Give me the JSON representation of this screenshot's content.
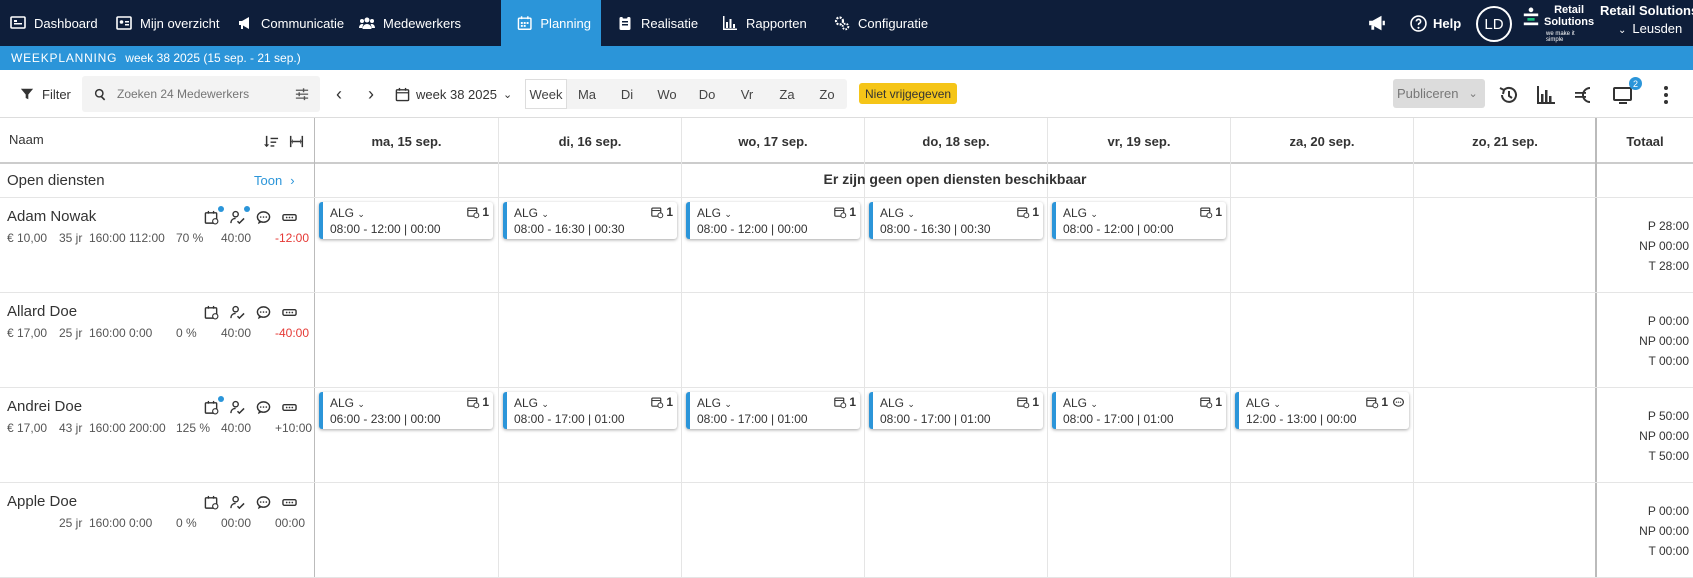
{
  "nav": {
    "items": [
      {
        "label": "Dashboard",
        "icon": "dashboard-icon"
      },
      {
        "label": "Mijn overzicht",
        "icon": "id-card-icon"
      },
      {
        "label": "Communicatie",
        "icon": "megaphone-icon"
      },
      {
        "label": "Medewerkers",
        "icon": "users-icon"
      },
      {
        "label": "Planning",
        "icon": "calendar-icon",
        "active": true
      },
      {
        "label": "Realisatie",
        "icon": "clipboard-icon"
      },
      {
        "label": "Rapporten",
        "icon": "bar-chart-icon"
      },
      {
        "label": "Configuratie",
        "icon": "gears-icon"
      }
    ],
    "help_label": "Help",
    "avatar_initials": "LD",
    "logo_line1": "Retail",
    "logo_line2": "Solutions",
    "logo_tagline": "we make it simple",
    "store_name": "Retail Solutions",
    "store_location": "Leusden"
  },
  "subbar": {
    "title": "WEEKPLANNING",
    "range": "week 38 2025 (15 sep. - 21 sep.)"
  },
  "toolbar": {
    "filter_label": "Filter",
    "search_placeholder": "Zoeken 24 Medewerkers",
    "week_label": "week 38 2025",
    "days": [
      "Week",
      "Ma",
      "Di",
      "Wo",
      "Do",
      "Vr",
      "Za",
      "Zo"
    ],
    "selected_day": "Week",
    "status_badge": "Niet vrijgegeven",
    "publish_label": "Publiceren",
    "notification_count": "2"
  },
  "grid": {
    "name_header": "Naam",
    "total_header": "Totaal",
    "columns": [
      "ma, 15 sep.",
      "di, 16 sep.",
      "wo, 17 sep.",
      "do, 18 sep.",
      "vr, 19 sep.",
      "za, 20 sep.",
      "zo, 21 sep."
    ],
    "open_label": "Open diensten",
    "open_toggle": "Toon",
    "open_message": "Er zijn geen open diensten beschikbaar"
  },
  "employees": [
    {
      "name": "Adam Nowak",
      "wage": "€ 10,00",
      "age": "35 jr",
      "contract": "160:00",
      "planned_month": "112:00",
      "percent": "70 %",
      "week_hours": "40:00",
      "delta": "-12:00",
      "delta_negative": true,
      "shifts": [
        {
          "day": 0,
          "code": "ALG",
          "time": "08:00 - 12:00 | 00:00",
          "count": "1"
        },
        {
          "day": 1,
          "code": "ALG",
          "time": "08:00 - 16:30 | 00:30",
          "count": "1"
        },
        {
          "day": 2,
          "code": "ALG",
          "time": "08:00 - 12:00 | 00:00",
          "count": "1"
        },
        {
          "day": 3,
          "code": "ALG",
          "time": "08:00 - 16:30 | 00:30",
          "count": "1"
        },
        {
          "day": 4,
          "code": "ALG",
          "time": "08:00 - 12:00 | 00:00",
          "count": "1"
        }
      ],
      "totals": {
        "P": "28:00",
        "NP": "00:00",
        "T": "28:00"
      }
    },
    {
      "name": "Allard Doe",
      "wage": "€ 17,00",
      "age": "25 jr",
      "contract": "160:00",
      "planned_month": "0:00",
      "percent": "0 %",
      "week_hours": "40:00",
      "delta": "-40:00",
      "delta_negative": true,
      "shifts": [],
      "totals": {
        "P": "00:00",
        "NP": "00:00",
        "T": "00:00"
      }
    },
    {
      "name": "Andrei Doe",
      "wage": "€ 17,00",
      "age": "43 jr",
      "contract": "160:00",
      "planned_month": "200:00",
      "percent": "125 %",
      "week_hours": "40:00",
      "delta": "+10:00",
      "delta_negative": false,
      "shifts": [
        {
          "day": 0,
          "code": "ALG",
          "time": "06:00 - 23:00 | 00:00",
          "count": "1"
        },
        {
          "day": 1,
          "code": "ALG",
          "time": "08:00 - 17:00 | 01:00",
          "count": "1"
        },
        {
          "day": 2,
          "code": "ALG",
          "time": "08:00 - 17:00 | 01:00",
          "count": "1"
        },
        {
          "day": 3,
          "code": "ALG",
          "time": "08:00 - 17:00 | 01:00",
          "count": "1"
        },
        {
          "day": 4,
          "code": "ALG",
          "time": "08:00 - 17:00 | 01:00",
          "count": "1"
        },
        {
          "day": 5,
          "code": "ALG",
          "time": "12:00 - 13:00 | 00:00",
          "count": "1",
          "comment": true
        }
      ],
      "totals": {
        "P": "50:00",
        "NP": "00:00",
        "T": "50:00"
      }
    },
    {
      "name": "Apple Doe",
      "wage": "",
      "age": "25 jr",
      "contract": "160:00",
      "planned_month": "0:00",
      "percent": "0 %",
      "week_hours": "00:00",
      "delta": "00:00",
      "delta_negative": false,
      "shifts": [],
      "totals": {
        "P": "00:00",
        "NP": "00:00",
        "T": "00:00"
      }
    }
  ]
}
